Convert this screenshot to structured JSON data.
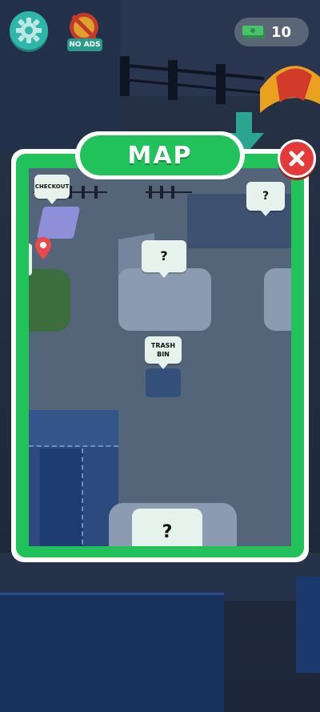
{
  "hud": {
    "settings_icon": "gear-icon",
    "no_ads_icon": "no-ads-icon",
    "no_ads_label": "NO ADS",
    "cash_icon": "cash-stack-icon",
    "cash_value": "10"
  },
  "map_modal": {
    "title": "MAP",
    "close_icon": "close-icon",
    "labels": {
      "checkout": "CHECKOUT",
      "trash_line1": "TRASH",
      "trash_line2": "BIN",
      "unknown_1": "?",
      "unknown_2": "?",
      "unknown_3": "?"
    },
    "location_pin_icon": "location-pin-icon"
  },
  "colors": {
    "accent_green": "#21c25a",
    "close_red": "#e53a3a",
    "settings_teal": "#2fb6a8",
    "map_floor": "#546479"
  }
}
